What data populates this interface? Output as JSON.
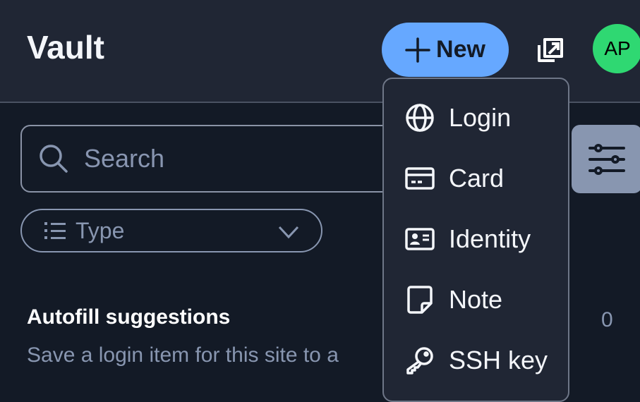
{
  "header": {
    "title": "Vault",
    "new_label": "New",
    "avatar_initials": "AP"
  },
  "search": {
    "placeholder": "Search"
  },
  "filters": {
    "type_label": "Type"
  },
  "autofill": {
    "title": "Autofill suggestions",
    "subtitle": "Save a login item for this site to a",
    "count": "0"
  },
  "new_menu": {
    "items": [
      {
        "label": "Login",
        "icon": "globe-icon"
      },
      {
        "label": "Card",
        "icon": "credit-card-icon"
      },
      {
        "label": "Identity",
        "icon": "id-card-icon"
      },
      {
        "label": "Note",
        "icon": "sticky-note-icon"
      },
      {
        "label": "SSH key",
        "icon": "key-icon"
      }
    ]
  },
  "colors": {
    "accent": "#66a8ff",
    "avatar": "#2fd872",
    "background": "#131a26",
    "header": "#202634"
  }
}
